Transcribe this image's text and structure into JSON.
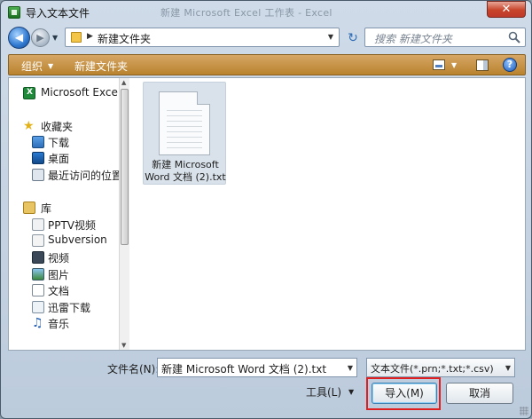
{
  "window": {
    "title": "导入文本文件",
    "background_title": "新建 Microsoft Excel 工作表 - Excel",
    "close_label": "✕"
  },
  "address": {
    "crumb": "新建文件夹",
    "search_placeholder": "搜索 新建文件夹"
  },
  "toolbar": {
    "organize_label": "组织",
    "new_folder_label": "新建文件夹",
    "help_label": "?"
  },
  "nav": {
    "items": [
      {
        "label": "Microsoft Excel",
        "icon": "excel-icon"
      },
      {
        "label": "收藏夹",
        "icon": "star-icon"
      },
      {
        "label": "下载",
        "icon": "download-folder-icon"
      },
      {
        "label": "桌面",
        "icon": "desktop-icon"
      },
      {
        "label": "最近访问的位置",
        "icon": "recent-places-icon"
      },
      {
        "label": "库",
        "icon": "library-icon"
      },
      {
        "label": "PPTV视频",
        "icon": "pptv-icon"
      },
      {
        "label": "Subversion",
        "icon": "subversion-icon"
      },
      {
        "label": "视频",
        "icon": "video-icon"
      },
      {
        "label": "图片",
        "icon": "pictures-icon"
      },
      {
        "label": "文档",
        "icon": "documents-icon"
      },
      {
        "label": "迅雷下载",
        "icon": "xunlei-icon"
      },
      {
        "label": "音乐",
        "icon": "music-icon"
      }
    ]
  },
  "files": [
    {
      "name_line1": "新建 Microsoft",
      "name_line2": "Word 文档 (2).txt",
      "icon": "text-file-icon"
    }
  ],
  "bottom": {
    "filename_label": "文件名(N):",
    "filename_value": "新建 Microsoft Word 文档 (2).txt",
    "filetype_value": "文本文件(*.prn;*.txt;*.csv)",
    "tools_label": "工具(L)",
    "import_label": "导入(M)",
    "cancel_label": "取消"
  },
  "colors": {
    "toolbar": "#c5913f",
    "highlight_box": "#e02020",
    "close_button": "#c7442a"
  }
}
